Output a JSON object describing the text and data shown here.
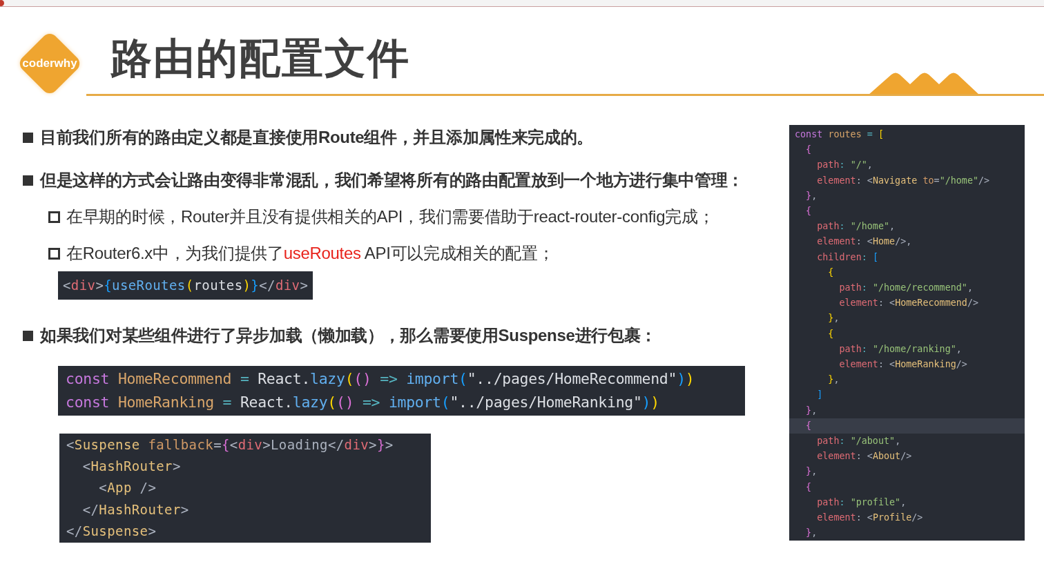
{
  "logo": {
    "text": "coderwhy"
  },
  "title": "路由的配置文件",
  "bullets": [
    {
      "kind": "main",
      "parts": [
        {
          "text": "目前我们所有的路由定义都是直接使用Route组件，并且添加属性来完成的。",
          "highlight": false
        }
      ]
    },
    {
      "kind": "main",
      "parts": [
        {
          "text": "但是这样的方式会让路由变得非常混乱，我们希望将所有的路由配置放到一个地方进行集中管理：",
          "highlight": false
        }
      ]
    },
    {
      "kind": "sub",
      "parts": [
        {
          "text": "在早期的时候，Router并且没有提供相关的API，我们需要借助于react-router-config完成；",
          "highlight": false
        }
      ]
    },
    {
      "kind": "sub",
      "parts": [
        {
          "text": "在Router6.x中，为我们提供了",
          "highlight": false
        },
        {
          "text": "useRoutes",
          "highlight": true
        },
        {
          "text": " API可以完成相关的配置；",
          "highlight": false
        }
      ]
    },
    {
      "kind": "code"
    },
    {
      "kind": "main",
      "parts": [
        {
          "text": "如果我们对某些组件进行了异步加载（懒加载），那么需要使用Suspense进行包裹：",
          "highlight": false
        }
      ]
    },
    {
      "kind": "code"
    },
    {
      "kind": "code"
    }
  ],
  "code_blocks": [
    {
      "lines": [
        [
          {
            "text": "<",
            "kind": "punct"
          },
          {
            "text": "div",
            "kind": "tag"
          },
          {
            "text": ">",
            "kind": "punct"
          },
          {
            "text": "{",
            "kind": "b3"
          },
          {
            "text": "useRoutes",
            "kind": "fn"
          },
          {
            "text": "(",
            "kind": "b1"
          },
          {
            "text": "routes",
            "kind": "plain"
          },
          {
            "text": ")",
            "kind": "b1"
          },
          {
            "text": "}",
            "kind": "b3"
          },
          {
            "text": "</",
            "kind": "punct"
          },
          {
            "text": "div",
            "kind": "tag"
          },
          {
            "text": ">",
            "kind": "punct"
          }
        ]
      ]
    },
    {
      "lines": [
        [
          {
            "text": "const ",
            "kind": "kw"
          },
          {
            "text": "HomeRecommend",
            "kind": "var"
          },
          {
            "text": " = ",
            "kind": "op"
          },
          {
            "text": "React.",
            "kind": "plain"
          },
          {
            "text": "lazy",
            "kind": "fn"
          },
          {
            "text": "(",
            "kind": "b1"
          },
          {
            "text": "()",
            "kind": "b2"
          },
          {
            "text": " => ",
            "kind": "op"
          },
          {
            "text": "import",
            "kind": "fn"
          },
          {
            "text": "(",
            "kind": "b3"
          },
          {
            "text": "\"../pages/HomeRecommend\"",
            "kind": "plain"
          },
          {
            "text": ")",
            "kind": "b3"
          },
          {
            "text": ")",
            "kind": "b1"
          }
        ],
        [
          {
            "text": "const ",
            "kind": "kw"
          },
          {
            "text": "HomeRanking",
            "kind": "var"
          },
          {
            "text": " = ",
            "kind": "op"
          },
          {
            "text": "React.",
            "kind": "plain"
          },
          {
            "text": "lazy",
            "kind": "fn"
          },
          {
            "text": "(",
            "kind": "b1"
          },
          {
            "text": "()",
            "kind": "b2"
          },
          {
            "text": " => ",
            "kind": "op"
          },
          {
            "text": "import",
            "kind": "fn"
          },
          {
            "text": "(",
            "kind": "b3"
          },
          {
            "text": "\"../pages/HomeRanking\"",
            "kind": "plain"
          },
          {
            "text": ")",
            "kind": "b3"
          },
          {
            "text": ")",
            "kind": "b1"
          }
        ]
      ]
    },
    {
      "lines": [
        [
          {
            "text": "<",
            "kind": "punct"
          },
          {
            "text": "Suspense",
            "kind": "comp"
          },
          {
            "text": " fallback",
            "kind": "attr"
          },
          {
            "text": "=",
            "kind": "punct"
          },
          {
            "text": "{",
            "kind": "b2"
          },
          {
            "text": "<",
            "kind": "punct"
          },
          {
            "text": "div",
            "kind": "tag"
          },
          {
            "text": ">Loading</",
            "kind": "punct"
          },
          {
            "text": "div",
            "kind": "tag"
          },
          {
            "text": ">",
            "kind": "punct"
          },
          {
            "text": "}",
            "kind": "b2"
          },
          {
            "text": ">",
            "kind": "punct"
          }
        ],
        [
          {
            "text": "  <",
            "kind": "punct"
          },
          {
            "text": "HashRouter",
            "kind": "comp"
          },
          {
            "text": ">",
            "kind": "punct"
          }
        ],
        [
          {
            "text": "    <",
            "kind": "punct"
          },
          {
            "text": "App",
            "kind": "comp"
          },
          {
            "text": " />",
            "kind": "punct"
          }
        ],
        [
          {
            "text": "  </",
            "kind": "punct"
          },
          {
            "text": "HashRouter",
            "kind": "comp"
          },
          {
            "text": ">",
            "kind": "punct"
          }
        ],
        [
          {
            "text": "</",
            "kind": "punct"
          },
          {
            "text": "Suspense",
            "kind": "comp"
          },
          {
            "text": ">",
            "kind": "punct"
          }
        ]
      ]
    }
  ],
  "routes_panel": {
    "lines": [
      {
        "current": false,
        "tokens": [
          {
            "text": "const ",
            "kind": "kw"
          },
          {
            "text": "routes",
            "kind": "var"
          },
          {
            "text": " = ",
            "kind": "op"
          },
          {
            "text": "[",
            "kind": "b1"
          }
        ]
      },
      {
        "current": false,
        "tokens": [
          {
            "text": "  {",
            "kind": "b2"
          }
        ]
      },
      {
        "current": false,
        "tokens": [
          {
            "text": "    path",
            "kind": "prop"
          },
          {
            "text": ": ",
            "kind": "op"
          },
          {
            "text": "\"/\"",
            "kind": "str"
          },
          {
            "text": ",",
            "kind": "punct"
          }
        ]
      },
      {
        "current": false,
        "tokens": [
          {
            "text": "    element",
            "kind": "prop"
          },
          {
            "text": ": <",
            "kind": "punct"
          },
          {
            "text": "Navigate",
            "kind": "comp"
          },
          {
            "text": " to",
            "kind": "attr"
          },
          {
            "text": "=",
            "kind": "punct"
          },
          {
            "text": "\"/home\"",
            "kind": "str"
          },
          {
            "text": "/>",
            "kind": "punct"
          }
        ]
      },
      {
        "current": false,
        "tokens": [
          {
            "text": "  }",
            "kind": "b2"
          },
          {
            "text": ",",
            "kind": "punct"
          }
        ]
      },
      {
        "current": false,
        "tokens": [
          {
            "text": "  {",
            "kind": "b2"
          }
        ]
      },
      {
        "current": false,
        "tokens": [
          {
            "text": "    path",
            "kind": "prop"
          },
          {
            "text": ": ",
            "kind": "op"
          },
          {
            "text": "\"/home\"",
            "kind": "str"
          },
          {
            "text": ",",
            "kind": "punct"
          }
        ]
      },
      {
        "current": false,
        "tokens": [
          {
            "text": "    element",
            "kind": "prop"
          },
          {
            "text": ": <",
            "kind": "punct"
          },
          {
            "text": "Home",
            "kind": "comp"
          },
          {
            "text": "/>,",
            "kind": "punct"
          }
        ]
      },
      {
        "current": false,
        "tokens": [
          {
            "text": "    children",
            "kind": "prop"
          },
          {
            "text": ": ",
            "kind": "op"
          },
          {
            "text": "[",
            "kind": "b3"
          }
        ]
      },
      {
        "current": false,
        "tokens": [
          {
            "text": "      {",
            "kind": "b1"
          }
        ]
      },
      {
        "current": false,
        "tokens": [
          {
            "text": "        path",
            "kind": "prop"
          },
          {
            "text": ": ",
            "kind": "op"
          },
          {
            "text": "\"/home/recommend\"",
            "kind": "str"
          },
          {
            "text": ",",
            "kind": "punct"
          }
        ]
      },
      {
        "current": false,
        "tokens": [
          {
            "text": "        element",
            "kind": "prop"
          },
          {
            "text": ": <",
            "kind": "punct"
          },
          {
            "text": "HomeRecommend",
            "kind": "comp"
          },
          {
            "text": "/>",
            "kind": "punct"
          }
        ]
      },
      {
        "current": false,
        "tokens": [
          {
            "text": "      }",
            "kind": "b1"
          },
          {
            "text": ",",
            "kind": "punct"
          }
        ]
      },
      {
        "current": false,
        "tokens": [
          {
            "text": "      {",
            "kind": "b1"
          }
        ]
      },
      {
        "current": false,
        "tokens": [
          {
            "text": "        path",
            "kind": "prop"
          },
          {
            "text": ": ",
            "kind": "op"
          },
          {
            "text": "\"/home/ranking\"",
            "kind": "str"
          },
          {
            "text": ",",
            "kind": "punct"
          }
        ]
      },
      {
        "current": false,
        "tokens": [
          {
            "text": "        element",
            "kind": "prop"
          },
          {
            "text": ": <",
            "kind": "punct"
          },
          {
            "text": "HomeRanking",
            "kind": "comp"
          },
          {
            "text": "/>",
            "kind": "punct"
          }
        ]
      },
      {
        "current": false,
        "tokens": [
          {
            "text": "      }",
            "kind": "b1"
          },
          {
            "text": ",",
            "kind": "punct"
          }
        ]
      },
      {
        "current": false,
        "tokens": [
          {
            "text": "    ]",
            "kind": "b3"
          }
        ]
      },
      {
        "current": false,
        "tokens": [
          {
            "text": "  }",
            "kind": "b2"
          },
          {
            "text": ",",
            "kind": "punct"
          }
        ]
      },
      {
        "current": true,
        "tokens": [
          {
            "text": "  {",
            "kind": "b2"
          }
        ]
      },
      {
        "current": false,
        "tokens": [
          {
            "text": "    path",
            "kind": "prop"
          },
          {
            "text": ": ",
            "kind": "op"
          },
          {
            "text": "\"/about\"",
            "kind": "str"
          },
          {
            "text": ",",
            "kind": "punct"
          }
        ]
      },
      {
        "current": false,
        "tokens": [
          {
            "text": "    element",
            "kind": "prop"
          },
          {
            "text": ": <",
            "kind": "punct"
          },
          {
            "text": "About",
            "kind": "comp"
          },
          {
            "text": "/>",
            "kind": "punct"
          }
        ]
      },
      {
        "current": false,
        "tokens": [
          {
            "text": "  }",
            "kind": "b2"
          },
          {
            "text": ",",
            "kind": "punct"
          }
        ]
      },
      {
        "current": false,
        "tokens": [
          {
            "text": "  {",
            "kind": "b2"
          }
        ]
      },
      {
        "current": false,
        "tokens": [
          {
            "text": "    path",
            "kind": "prop"
          },
          {
            "text": ": ",
            "kind": "op"
          },
          {
            "text": "\"profile\"",
            "kind": "str"
          },
          {
            "text": ",",
            "kind": "punct"
          }
        ]
      },
      {
        "current": false,
        "tokens": [
          {
            "text": "    element",
            "kind": "prop"
          },
          {
            "text": ": <",
            "kind": "punct"
          },
          {
            "text": "Profile",
            "kind": "comp"
          },
          {
            "text": "/>",
            "kind": "punct"
          }
        ]
      },
      {
        "current": false,
        "tokens": [
          {
            "text": "  }",
            "kind": "b2"
          },
          {
            "text": ",",
            "kind": "punct"
          }
        ]
      }
    ]
  }
}
